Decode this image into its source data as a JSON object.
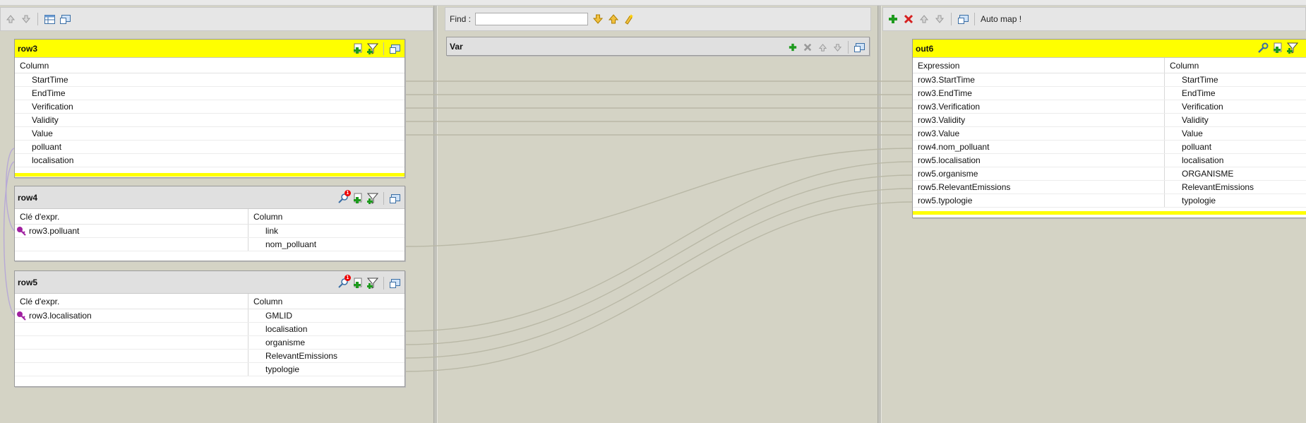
{
  "toolbars": {
    "left": {
      "icons": [
        "arrow-up-icon",
        "arrow-down-icon",
        "table-icon",
        "window-icon"
      ]
    },
    "center": {
      "find_label": "Find :",
      "find_value": "",
      "find_placeholder": ""
    },
    "right": {
      "auto_map_label": "Auto map !"
    }
  },
  "var_panel": {
    "title": "Var"
  },
  "row3": {
    "title": "row3",
    "column_header": "Column",
    "columns": [
      "StartTime",
      "EndTime",
      "Verification",
      "Validity",
      "Value",
      "polluant",
      "localisation"
    ]
  },
  "row4": {
    "title": "row4",
    "badge": "1",
    "key_header": "Clé d'expr.",
    "column_header": "Column",
    "rows": [
      {
        "key": "row3.polluant",
        "column": "link"
      },
      {
        "key": "",
        "column": "nom_polluant"
      }
    ]
  },
  "row5": {
    "title": "row5",
    "badge": "1",
    "key_header": "Clé d'expr.",
    "column_header": "Column",
    "rows": [
      {
        "key": "row3.localisation",
        "column": "GMLID"
      },
      {
        "key": "",
        "column": "localisation"
      },
      {
        "key": "",
        "column": "organisme"
      },
      {
        "key": "",
        "column": "RelevantEmissions"
      },
      {
        "key": "",
        "column": "typologie"
      }
    ]
  },
  "out6": {
    "title": "out6",
    "expression_header": "Expression",
    "column_header": "Column",
    "rows": [
      {
        "expression": "row3.StartTime",
        "column": "StartTime"
      },
      {
        "expression": "row3.EndTime",
        "column": "EndTime"
      },
      {
        "expression": "row3.Verification",
        "column": "Verification"
      },
      {
        "expression": "row3.Validity",
        "column": "Validity"
      },
      {
        "expression": "row3.Value",
        "column": "Value"
      },
      {
        "expression": "row4.nom_polluant",
        "column": "polluant"
      },
      {
        "expression": "row5.localisation",
        "column": "localisation"
      },
      {
        "expression": "row5.organisme",
        "column": "ORGANISME"
      },
      {
        "expression": "row5.RelevantEmissions",
        "column": "RelevantEmissions"
      },
      {
        "expression": "row5.typologie",
        "column": "typologie"
      }
    ]
  },
  "colors": {
    "header_yellow": "#ffff00",
    "link_line": "#b9b8a6",
    "key_purple": "#a020a0",
    "add_green": "#1e9a1e",
    "delete_red": "#d62020"
  }
}
